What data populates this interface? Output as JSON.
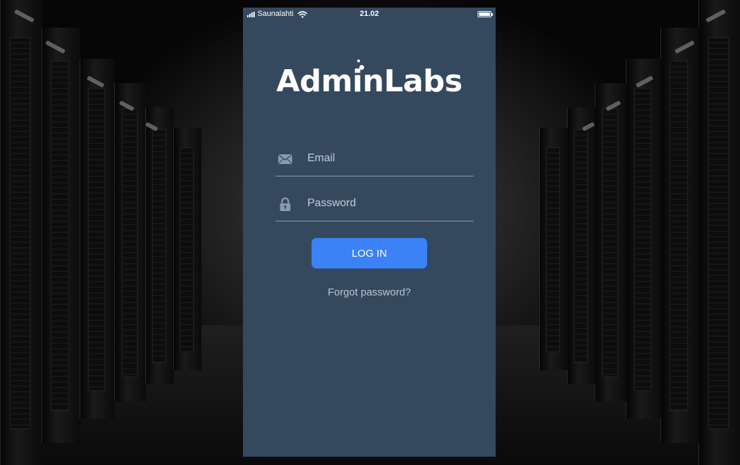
{
  "status_bar": {
    "carrier": "Saunalahti",
    "time": "21.02",
    "icons": [
      "signal-icon",
      "wifi-icon",
      "battery-icon"
    ]
  },
  "logo": {
    "text": "AdminLabs"
  },
  "form": {
    "email": {
      "icon": "envelope-icon",
      "placeholder": "Email",
      "value": ""
    },
    "password": {
      "icon": "lock-icon",
      "placeholder": "Password",
      "value": ""
    },
    "login_label": "LOG IN",
    "forgot_label": "Forgot password?"
  },
  "colors": {
    "screen_background": "#34495e",
    "button": "#3b82f6",
    "text": "#ffffff",
    "muted_text": "#bcc5d0"
  }
}
